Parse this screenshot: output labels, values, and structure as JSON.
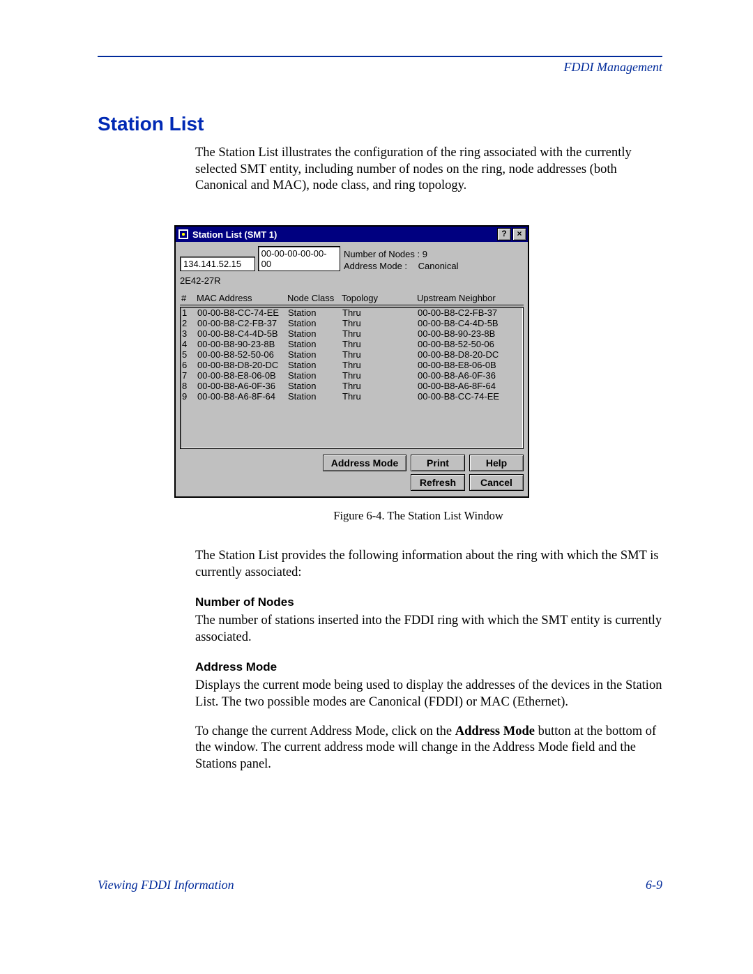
{
  "header": {
    "breadcrumb": "FDDI Management"
  },
  "section": {
    "title": "Station List",
    "intro": "The Station List illustrates the configuration of the ring associated with the currently selected SMT entity, including number of nodes on the ring, node addresses (both Canonical and MAC), node class, and ring topology.",
    "figure_caption": "Figure 6-4.  The Station List Window",
    "after_figure": "The Station List provides the following information about the ring with which the SMT is currently associated:",
    "num_nodes": {
      "heading": "Number of Nodes",
      "text": "The number of stations inserted into the FDDI ring with which the SMT entity is currently associated."
    },
    "addr_mode": {
      "heading": "Address Mode",
      "text": "Displays the current mode being used to display the addresses of the devices in the Station List. The two possible modes are Canonical (FDDI) or MAC (Ethernet).",
      "text2a": "To change the current Address Mode, click on the ",
      "text2b": "Address Mode",
      "text2c": " button at the bottom of the window. The current address mode will change in the Address Mode field and the Stations panel."
    }
  },
  "window": {
    "title": "Station List (SMT 1)",
    "help_glyph": "?",
    "close_glyph": "×",
    "ip_field": "134.141.52.15",
    "mac_field": "00-00-00-00-00-00",
    "device_name": "2E42-27R",
    "nodes_label": "Number of Nodes :",
    "nodes_value": "9",
    "mode_label": "Address Mode :",
    "mode_value": "Canonical",
    "columns": {
      "c0": "#",
      "c1": "MAC Address",
      "c2": "Node Class",
      "c3": "Topology",
      "c4": "Upstream Neighbor"
    },
    "rows": [
      {
        "n": "1",
        "mac": "00-00-B8-CC-74-EE",
        "cls": "Station",
        "top": "Thru",
        "up": "00-00-B8-C2-FB-37"
      },
      {
        "n": "2",
        "mac": "00-00-B8-C2-FB-37",
        "cls": "Station",
        "top": "Thru",
        "up": "00-00-B8-C4-4D-5B"
      },
      {
        "n": "3",
        "mac": "00-00-B8-C4-4D-5B",
        "cls": "Station",
        "top": "Thru",
        "up": "00-00-B8-90-23-8B"
      },
      {
        "n": "4",
        "mac": "00-00-B8-90-23-8B",
        "cls": "Station",
        "top": "Thru",
        "up": "00-00-B8-52-50-06"
      },
      {
        "n": "5",
        "mac": "00-00-B8-52-50-06",
        "cls": "Station",
        "top": "Thru",
        "up": "00-00-B8-D8-20-DC"
      },
      {
        "n": "6",
        "mac": "00-00-B8-D8-20-DC",
        "cls": "Station",
        "top": "Thru",
        "up": "00-00-B8-E8-06-0B"
      },
      {
        "n": "7",
        "mac": "00-00-B8-E8-06-0B",
        "cls": "Station",
        "top": "Thru",
        "up": "00-00-B8-A6-0F-36"
      },
      {
        "n": "8",
        "mac": "00-00-B8-A6-0F-36",
        "cls": "Station",
        "top": "Thru",
        "up": "00-00-B8-A6-8F-64"
      },
      {
        "n": "9",
        "mac": "00-00-B8-A6-8F-64",
        "cls": "Station",
        "top": "Thru",
        "up": "00-00-B8-CC-74-EE"
      }
    ],
    "buttons": {
      "address_mode": "Address Mode",
      "print": "Print",
      "help": "Help",
      "refresh": "Refresh",
      "cancel": "Cancel"
    }
  },
  "footer": {
    "left": "Viewing FDDI Information",
    "right": "6-9"
  }
}
